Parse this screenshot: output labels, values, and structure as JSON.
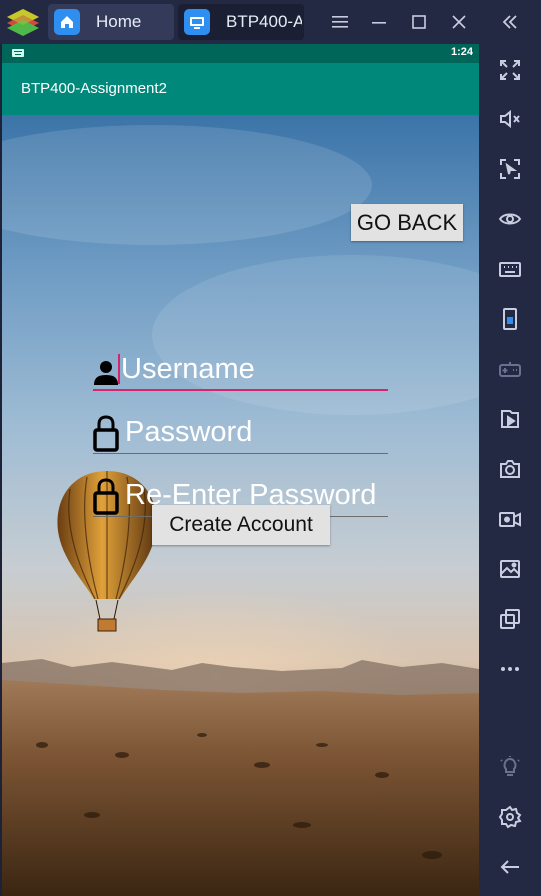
{
  "emulator": {
    "tabs": [
      {
        "label": "Home"
      },
      {
        "label": "BTP400-A:"
      }
    ]
  },
  "status_bar": {
    "time": "1:24"
  },
  "app_bar": {
    "title": "BTP400-Assignment2"
  },
  "form": {
    "go_back_label": "GO BACK",
    "username_placeholder": "Username",
    "password_placeholder": "Password",
    "reenter_placeholder": "Re-Enter Password",
    "create_account_label": "Create Account"
  },
  "colors": {
    "app_bar": "#00897b",
    "status_bar": "#00665a",
    "accent": "#d6246e",
    "emulator_chrome": "#232843"
  },
  "icons": {
    "sidebar": [
      "fullscreen-icon",
      "mute-icon",
      "cursor-lock-icon",
      "eye-icon",
      "keyboard-icon",
      "phone-icon",
      "gamepad-icon",
      "media-import-icon",
      "camera-icon",
      "record-icon",
      "gallery-icon",
      "multi-instance-icon",
      "more-icon",
      "brightness-icon",
      "settings-icon",
      "back-arrow-icon"
    ]
  }
}
